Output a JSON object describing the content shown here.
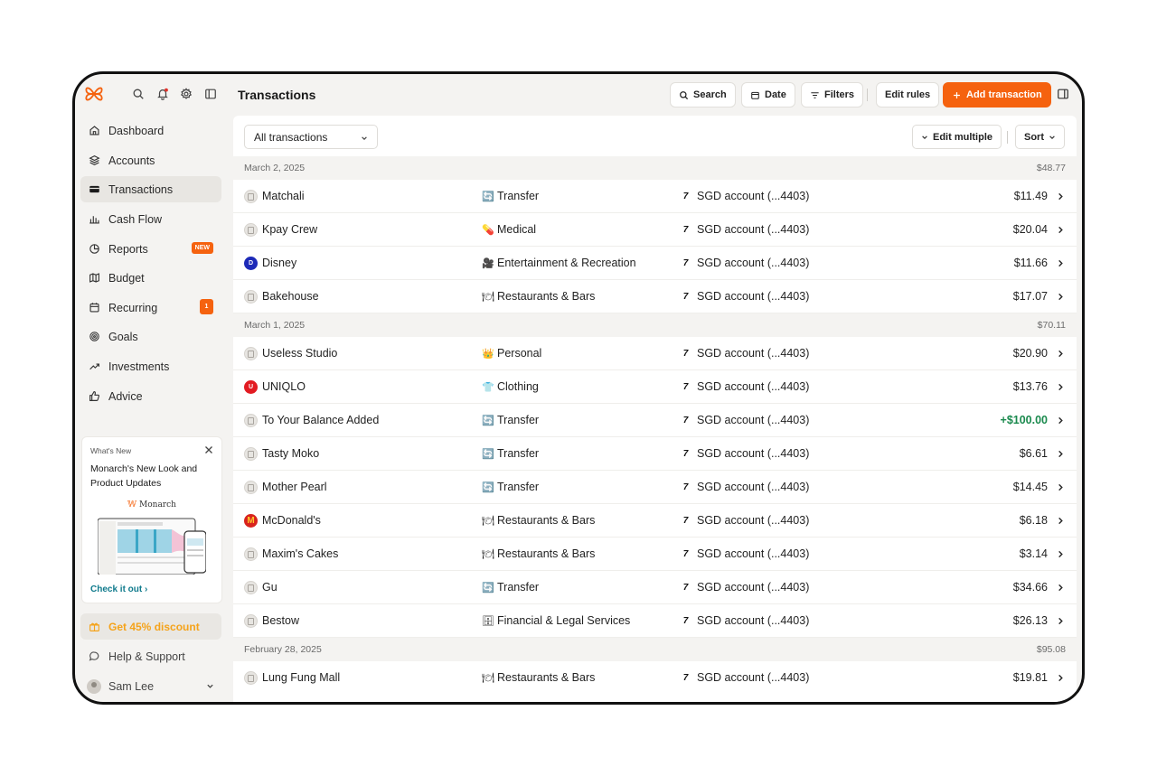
{
  "app": {
    "page_title": "Transactions"
  },
  "toolbar": {
    "search_label": "Search",
    "date_label": "Date",
    "filters_label": "Filters",
    "edit_rules_label": "Edit rules",
    "add_transaction_label": "Add transaction"
  },
  "colors": {
    "accent": "#f5620f",
    "positive": "#1b8a4e",
    "link": "#0f7a8c",
    "discount": "#f5a31a"
  },
  "sidebar": {
    "items": [
      {
        "label": "Dashboard",
        "icon": "home-icon"
      },
      {
        "label": "Accounts",
        "icon": "layers-icon"
      },
      {
        "label": "Transactions",
        "icon": "card-icon"
      },
      {
        "label": "Cash Flow",
        "icon": "bar-chart-icon"
      },
      {
        "label": "Reports",
        "icon": "pie-icon",
        "badge": "NEW"
      },
      {
        "label": "Budget",
        "icon": "map-icon"
      },
      {
        "label": "Recurring",
        "icon": "calendar-icon",
        "badge": "1"
      },
      {
        "label": "Goals",
        "icon": "target-icon"
      },
      {
        "label": "Investments",
        "icon": "trend-icon"
      },
      {
        "label": "Advice",
        "icon": "thumbs-up-icon"
      }
    ],
    "whats_new": {
      "label": "What's New",
      "title": "Monarch's New Look and Product Updates",
      "brand": "Monarch",
      "link": "Check it out"
    },
    "discount_label": "Get 45% discount",
    "help_label": "Help & Support",
    "user_name": "Sam Lee"
  },
  "filters": {
    "view_select": "All transactions",
    "edit_multiple_label": "Edit multiple",
    "sort_label": "Sort"
  },
  "groups": [
    {
      "date": "March 2, 2025",
      "total": "$48.77",
      "transactions": [
        {
          "merchant": "Matchali",
          "logo": "generic",
          "category": "Transfer",
          "cat_icon": "🔄",
          "account": "SGD account (...4403)",
          "amount": "$11.49",
          "positive": false
        },
        {
          "merchant": "Kpay Crew",
          "logo": "generic",
          "category": "Medical",
          "cat_icon": "💊",
          "account": "SGD account (...4403)",
          "amount": "$20.04",
          "positive": false
        },
        {
          "merchant": "Disney",
          "logo": "disney",
          "category": "Entertainment & Recreation",
          "cat_icon": "🎥",
          "account": "SGD account (...4403)",
          "amount": "$11.66",
          "positive": false
        },
        {
          "merchant": "Bakehouse",
          "logo": "generic",
          "category": "Restaurants & Bars",
          "cat_icon": "🍽",
          "account": "SGD account (...4403)",
          "amount": "$17.07",
          "positive": false
        }
      ]
    },
    {
      "date": "March 1, 2025",
      "total": "$70.11",
      "transactions": [
        {
          "merchant": "Useless Studio",
          "logo": "generic",
          "category": "Personal",
          "cat_icon": "👑",
          "account": "SGD account (...4403)",
          "amount": "$20.90",
          "positive": false
        },
        {
          "merchant": "UNIQLO",
          "logo": "uniqlo",
          "category": "Clothing",
          "cat_icon": "👕",
          "account": "SGD account (...4403)",
          "amount": "$13.76",
          "positive": false
        },
        {
          "merchant": "To Your Balance Added",
          "logo": "generic",
          "category": "Transfer",
          "cat_icon": "🔄",
          "account": "SGD account (...4403)",
          "amount": "+$100.00",
          "positive": true
        },
        {
          "merchant": "Tasty Moko",
          "logo": "generic",
          "category": "Transfer",
          "cat_icon": "🔄",
          "account": "SGD account (...4403)",
          "amount": "$6.61",
          "positive": false
        },
        {
          "merchant": "Mother Pearl",
          "logo": "generic",
          "category": "Transfer",
          "cat_icon": "🔄",
          "account": "SGD account (...4403)",
          "amount": "$14.45",
          "positive": false
        },
        {
          "merchant": "McDonald's",
          "logo": "mcd",
          "category": "Restaurants & Bars",
          "cat_icon": "🍽",
          "account": "SGD account (...4403)",
          "amount": "$6.18",
          "positive": false
        },
        {
          "merchant": "Maxim's Cakes",
          "logo": "generic",
          "category": "Restaurants & Bars",
          "cat_icon": "🍽",
          "account": "SGD account (...4403)",
          "amount": "$3.14",
          "positive": false
        },
        {
          "merchant": "Gu",
          "logo": "generic",
          "category": "Transfer",
          "cat_icon": "🔄",
          "account": "SGD account (...4403)",
          "amount": "$34.66",
          "positive": false
        },
        {
          "merchant": "Bestow",
          "logo": "generic",
          "category": "Financial & Legal Services",
          "cat_icon": "🗄",
          "account": "SGD account (...4403)",
          "amount": "$26.13",
          "positive": false
        }
      ]
    },
    {
      "date": "February 28, 2025",
      "total": "$95.08",
      "transactions": [
        {
          "merchant": "Lung Fung Mall",
          "logo": "generic",
          "category": "Restaurants & Bars",
          "cat_icon": "🍽",
          "account": "SGD account (...4403)",
          "amount": "$19.81",
          "positive": false
        }
      ]
    }
  ]
}
